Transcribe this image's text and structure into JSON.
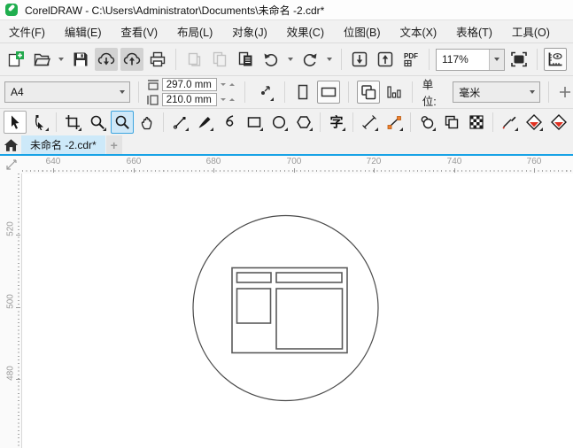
{
  "window": {
    "title": "CorelDRAW - C:\\Users\\Administrator\\Documents\\未命名 -2.cdr*"
  },
  "menu": {
    "items": [
      "文件(F)",
      "编辑(E)",
      "查看(V)",
      "布局(L)",
      "对象(J)",
      "效果(C)",
      "位图(B)",
      "文本(X)",
      "表格(T)",
      "工具(O)"
    ]
  },
  "toolbar": {
    "zoom_value": "117%",
    "pdf_label": "PDF"
  },
  "property_bar": {
    "page_size": "A4",
    "page_width": "297.0 mm",
    "page_height": "210.0 mm",
    "units_label": "单位:",
    "units_value": "毫米"
  },
  "toolbox": {
    "text_tool_glyph": "字"
  },
  "tabbar": {
    "active_tab": "未命名 -2.cdr*",
    "new_tab_label": "+"
  },
  "rulers": {
    "horizontal": [
      "640",
      "660",
      "680",
      "700",
      "720",
      "740",
      "760"
    ],
    "vertical": [
      "520",
      "500",
      "480"
    ]
  },
  "colors": {
    "accent_blue": "#18a3e6",
    "active_tool_bg": "#cfe8f8",
    "active_tool_border": "#3da5e0",
    "logo_green": "#1fae4e",
    "connector_orange": "#f08030",
    "fill_red": "#e03020"
  }
}
